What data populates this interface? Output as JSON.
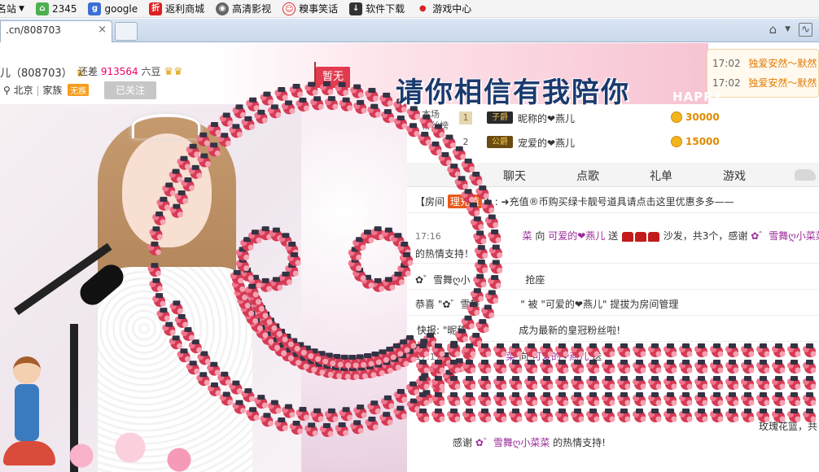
{
  "bookmarks": [
    {
      "label": "名站",
      "icon": "star-icon"
    },
    {
      "label": "2345",
      "icon": "house-icon"
    },
    {
      "label": "google",
      "icon": "g-icon"
    },
    {
      "label": "返利商城",
      "icon": "zhe-icon"
    },
    {
      "label": "高清影视",
      "icon": "film-icon"
    },
    {
      "label": "糗事笑话",
      "icon": "smile-icon"
    },
    {
      "label": "软件下载",
      "icon": "download-icon"
    },
    {
      "label": "游戏中心",
      "icon": "game-icon"
    }
  ],
  "tab": {
    "title": ".cn/808703",
    "close": "×"
  },
  "room": {
    "name": "儿（808703）",
    "gap_label": "还差",
    "gap_value": "913564",
    "gap_unit": "六豆",
    "location": "北京",
    "clan_label": "家族",
    "clan_badge": "无族",
    "follow_label": "已关注",
    "flag_text": "暂无",
    "slogan": "请你相信有我陪你",
    "banner_word": "HAPPY"
  },
  "chat_log": [
    {
      "time": "17:02",
      "text": "独爱安然～默然"
    },
    {
      "time": "17:02",
      "text": "独爱安然～默然"
    }
  ],
  "rank": {
    "label": "本场\n粉丝榜",
    "rows": [
      {
        "no": "1",
        "badge": "子爵",
        "name": "昵称的❤燕儿",
        "score": "30000"
      },
      {
        "no": "2",
        "badge": "公爵",
        "name": "宠爱的❤燕儿",
        "score": "15000"
      }
    ]
  },
  "nav": [
    "聊天",
    "点歌",
    "礼单",
    "游戏"
  ],
  "messages": {
    "notice_prefix": "【房间",
    "notice_badge": "理充值",
    "notice_text": "】: ➜充值®币购买绿卡靓号道具请点击这里优惠多多——",
    "m1_time": "17:16",
    "m1_sender": "菜",
    "m1_to": "向",
    "m1_receiver": "可爱的❤燕儿",
    "m1_send": "送",
    "m1_tail": "沙发，共3个，感谢",
    "m1_thanks": "✿゛雪舞ღ小菜菜",
    "m1_line2": "的热情支持！",
    "m2_user": "✿゛雪舞ღ小",
    "m2_text": "抢座",
    "m3_prefix": "恭喜 \"✿゛雪舞",
    "m3_mid": "\" 被",
    "m3_receiver": "\"可爱的❤燕儿\"",
    "m3_text": "提拔为房间管理",
    "m4_label": "快报:",
    "m4_user": "\"昵称",
    "m4_text": "成为最新的皇冠粉丝啦!",
    "m5_time": "17:17",
    "m5_sender": "菜",
    "m5_to": "向",
    "m5_receiver": "可爱的❤燕儿",
    "m5_send": "送",
    "m5_tail": "玫瑰花篮，共",
    "m5_line2_pre": "感谢",
    "m5_thanks": "✿゛雪舞ღ小菜菜",
    "m5_line2_post": "的热情支持!"
  },
  "colors": {
    "accent": "#e23a4e",
    "orange": "#e07a00",
    "purple": "#9b2b9b"
  }
}
